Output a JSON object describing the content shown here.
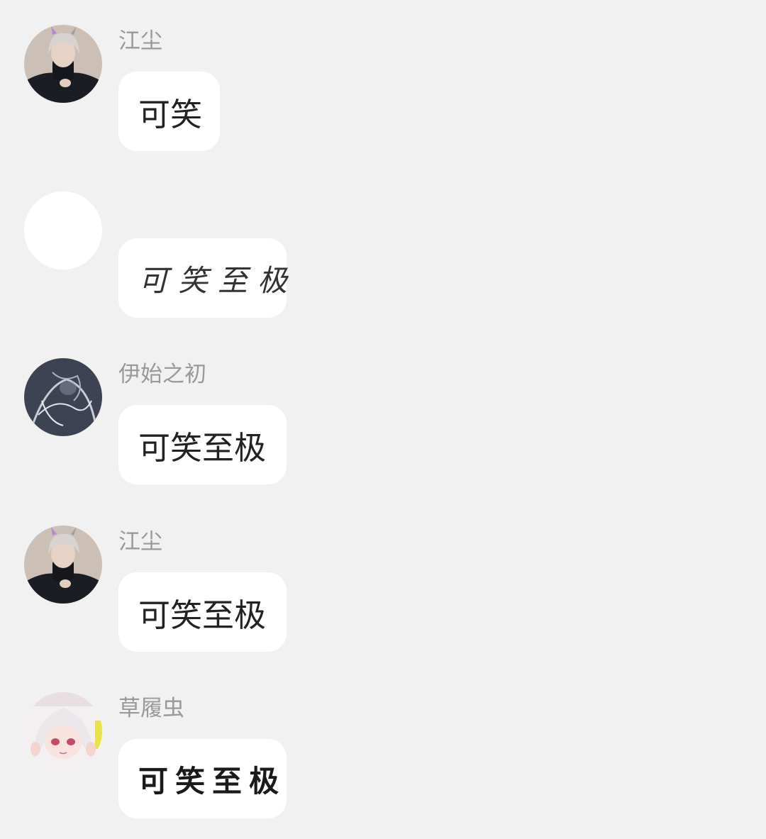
{
  "colors": {
    "background": "#f1f1f1",
    "bubble": "#ffffff",
    "sender_name": "#999999",
    "message_text": "#222222"
  },
  "messages": [
    {
      "sender": "江尘",
      "avatar": "avatar-boy-icon",
      "text": "可笑"
    },
    {
      "sender": "",
      "avatar": "avatar-blank-icon",
      "text": "可笑至极"
    },
    {
      "sender": "伊始之初",
      "avatar": "avatar-sketch-icon",
      "text": "可笑至极"
    },
    {
      "sender": "江尘",
      "avatar": "avatar-boy-icon",
      "text": "可笑至极"
    },
    {
      "sender": "草履虫",
      "avatar": "avatar-girl-icon",
      "text": "可笑至极"
    }
  ]
}
